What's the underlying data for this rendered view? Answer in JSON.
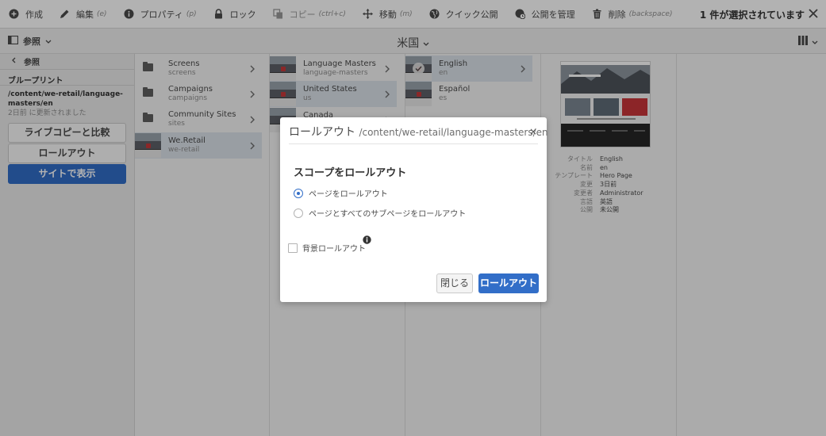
{
  "toolbar": {
    "create": "作成",
    "edit": "編集",
    "edit_kb": "(e)",
    "properties": "プロパティ",
    "properties_kb": "(p)",
    "lock": "ロック",
    "copy": "コピー",
    "copy_kb": "(ctrl+c)",
    "move": "移動",
    "move_kb": "(m)",
    "quick_publish": "クイック公開",
    "manage_publication": "公開を管理",
    "delete": "削除",
    "delete_kb": "(backspace)",
    "selection_count": "1 件が選択されています"
  },
  "subbar": {
    "rail_label": "参照",
    "title": "米国"
  },
  "rail": {
    "back_label": "参照",
    "section": "ブループリント",
    "path": "/content/we-retail/language-masters/en",
    "updated": "2日前 に更新されました",
    "compare_button": "ライブコピーと比較",
    "rollout_button": "ロールアウト",
    "view_site_button": "サイトで表示"
  },
  "columns": [
    {
      "items": [
        {
          "title": "Screens",
          "sub": "screens",
          "type": "folder",
          "active": false
        },
        {
          "title": "Campaigns",
          "sub": "campaigns",
          "type": "folder",
          "active": false
        },
        {
          "title": "Community Sites",
          "sub": "sites",
          "type": "folder",
          "active": false
        },
        {
          "title": "We.Retail",
          "sub": "we-retail",
          "type": "page",
          "active": true
        }
      ]
    },
    {
      "items": [
        {
          "title": "Language Masters",
          "sub": "language-masters",
          "type": "page",
          "active": false
        },
        {
          "title": "United States",
          "sub": "us",
          "type": "page",
          "active": true
        },
        {
          "title": "Canada",
          "sub": "",
          "type": "page",
          "active": false
        }
      ]
    },
    {
      "items": [
        {
          "title": "English",
          "sub": "en",
          "type": "page",
          "active": true
        },
        {
          "title": "Español",
          "sub": "es",
          "type": "page",
          "active": false
        }
      ]
    }
  ],
  "preview": {
    "meta": [
      {
        "k": "タイトル",
        "v": "English"
      },
      {
        "k": "名前",
        "v": "en"
      },
      {
        "k": "テンプレート",
        "v": "Hero Page"
      },
      {
        "k": "変更",
        "v": "3日前"
      },
      {
        "k": "変更者",
        "v": "Administrator"
      },
      {
        "k": "言語",
        "v": "英語"
      },
      {
        "k": "公開",
        "v": "未公開"
      }
    ]
  },
  "modal": {
    "title": "ロールアウト",
    "path": "/content/we-retail/language-masters/en",
    "close_glyph": "×",
    "heading": "スコープをロールアウト",
    "option_page": "ページをロールアウト",
    "option_page_subpages": "ページとすべてのサブページをロールアウト",
    "background_rollout": "背景ロールアウト",
    "close_button": "閉じる",
    "rollout_button": "ロールアウト"
  },
  "colors": {
    "accent": "#326ec8",
    "selected_row": "#dbe2ea"
  }
}
